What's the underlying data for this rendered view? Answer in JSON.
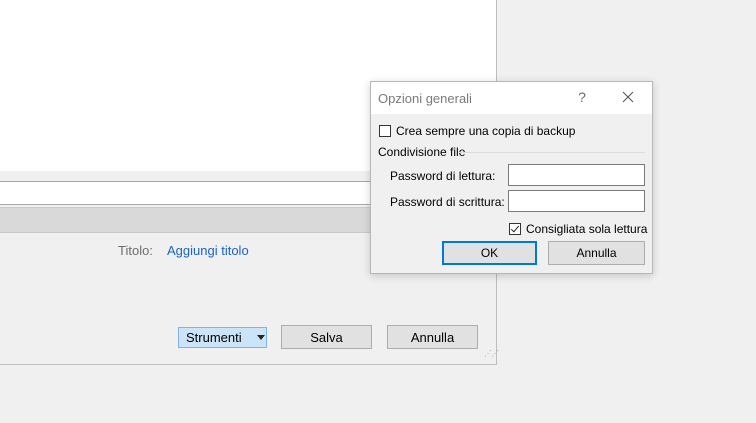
{
  "background": {
    "title_label": "Titolo:",
    "title_link": "Aggiungi titolo",
    "tools_label": "Strumenti",
    "save_label": "Salva",
    "cancel_label": "Annulla"
  },
  "dialog": {
    "title": "Opzioni generali",
    "help_label": "?",
    "backup_checkbox": {
      "label": "Crea sempre una copia di backup",
      "checked": false
    },
    "group_label": "Condivisione file",
    "read_password": {
      "label": "Password di lettura:",
      "value": ""
    },
    "write_password": {
      "label": "Password di scrittura:",
      "value": ""
    },
    "readonly_checkbox": {
      "label": "Consigliata sola lettura",
      "checked": true
    },
    "ok_label": "OK",
    "cancel_label": "Annulla"
  },
  "colors": {
    "link": "#1a63c7",
    "default_button_border": "#0078d7",
    "tools_button_bg": "#cce4f7"
  }
}
